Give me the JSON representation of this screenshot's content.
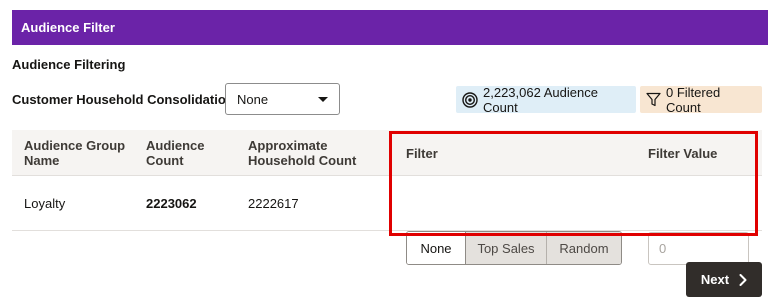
{
  "header": {
    "title": "Audience Filter"
  },
  "section": {
    "title": "Audience Filtering",
    "consolidation_label": "Customer Household Consolidation",
    "consolidation_value": "None"
  },
  "badges": {
    "audience_count": "2,223,062 Audience Count",
    "filtered_count": "0 Filtered Count",
    "audience_icon": "target-icon",
    "filtered_icon": "filter-icon",
    "audience_bg": "#dfeef7",
    "filtered_bg": "#f8e6d2"
  },
  "table": {
    "headers": {
      "group_line1": "Audience Group",
      "group_line2": "Name",
      "count_line1": "Audience",
      "count_line2": "Count",
      "household_line1": "Approximate",
      "household_line2": "Household Count",
      "filter": "Filter",
      "filter_value": "Filter Value"
    },
    "rows": [
      {
        "group": "Loyalty",
        "count": "2223062",
        "household": "2222617",
        "filter_options": [
          "None",
          "Top Sales",
          "Random"
        ],
        "selected_filter": "None",
        "filter_value_placeholder": "0"
      }
    ]
  },
  "footer": {
    "next_label": "Next"
  },
  "colors": {
    "header_bg": "#6b23a8",
    "highlight": "#e00000",
    "button_bg": "#312d2a"
  }
}
